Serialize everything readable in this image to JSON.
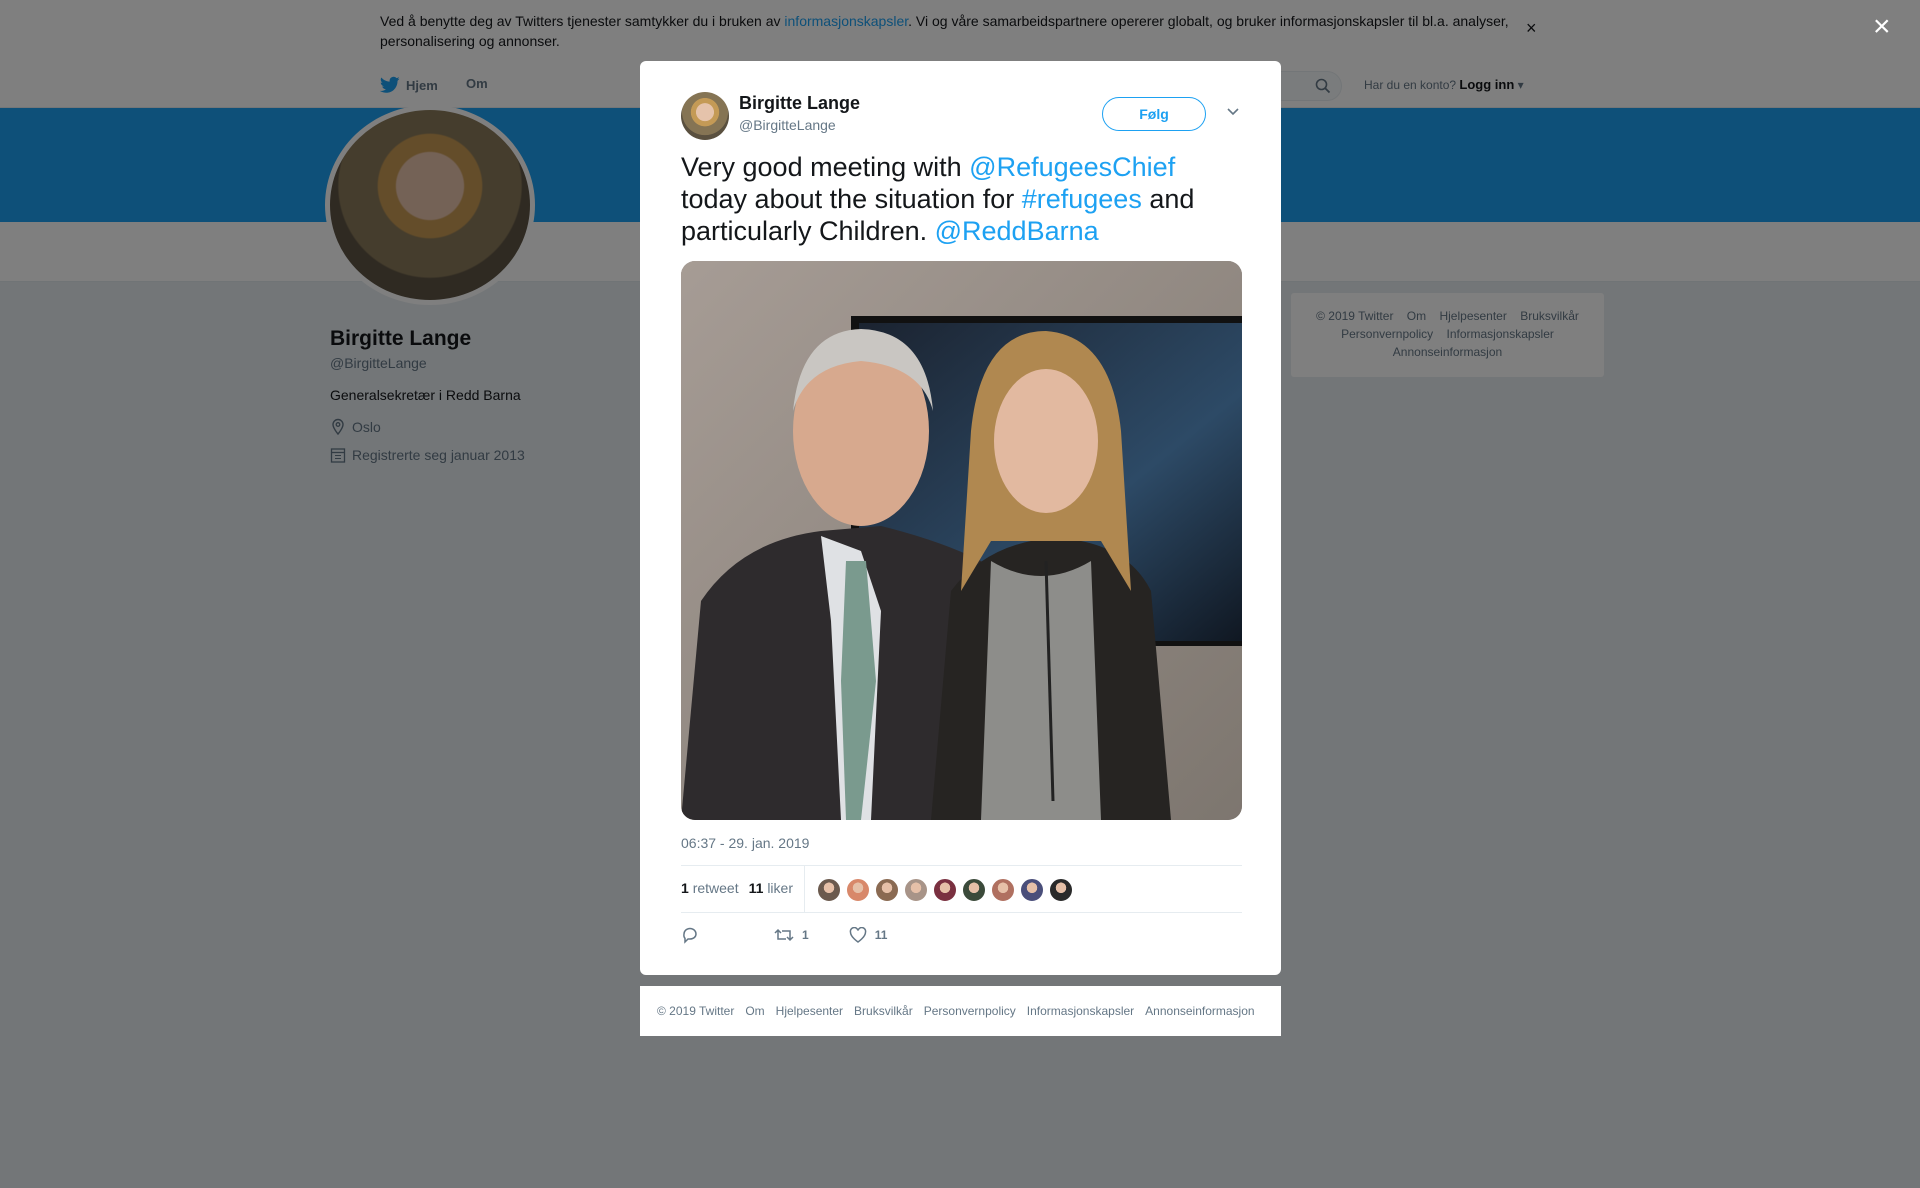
{
  "cookie": {
    "text_before": "Ved å benytte deg av Twitters tjenester samtykker du i bruken av ",
    "link": "informasjonskapsler",
    "text_after": ". Vi og våre samarbeidspartnere opererer globalt, og bruker informasjonskapsler til bl.a. analyser, personalisering og annonser.",
    "close": "×"
  },
  "nav": {
    "home": "Hjem",
    "about": "Om",
    "login_prompt": "Har du en konto?",
    "login": "Logg inn"
  },
  "profile": {
    "name": "Birgitte Lange",
    "handle": "@BirgitteLange",
    "bio": "Generalsekretær i Redd Barna",
    "location": "Oslo",
    "joined": "Registrerte seg januar 2013"
  },
  "side_footer": [
    "© 2019 Twitter",
    "Om",
    "Hjelpesenter",
    "Bruksvilkår",
    "Personvernpolicy",
    "Informasjonskapsler",
    "Annonseinformasjon"
  ],
  "overlay_close": "×",
  "tweet": {
    "name": "Birgitte Lange",
    "handle": "@BirgitteLange",
    "follow": "Følg",
    "text": {
      "p1": "Very good meeting with ",
      "m1": "@RefugeesChief",
      "p2": " today about the situation for ",
      "m2": "#refugees",
      "p3": " and particularly Children. ",
      "m3": "@ReddBarna"
    },
    "timestamp": "06:37 - 29. jan. 2019",
    "retweets_count": "1",
    "retweets_label": "retweet",
    "likes_count": "11",
    "likes_label": "liker",
    "action_retweets": "1",
    "action_likes": "11",
    "liker_colors": [
      "#6b5a4e",
      "#d8886a",
      "#8a6a52",
      "#a89488",
      "#7a3040",
      "#3b4a3a",
      "#b07060",
      "#4a4e7a",
      "#2a2a2a"
    ]
  },
  "modal_footer": [
    "© 2019 Twitter",
    "Om",
    "Hjelpesenter",
    "Bruksvilkår",
    "Personvernpolicy",
    "Informasjonskapsler",
    "Annonseinformasjon"
  ]
}
